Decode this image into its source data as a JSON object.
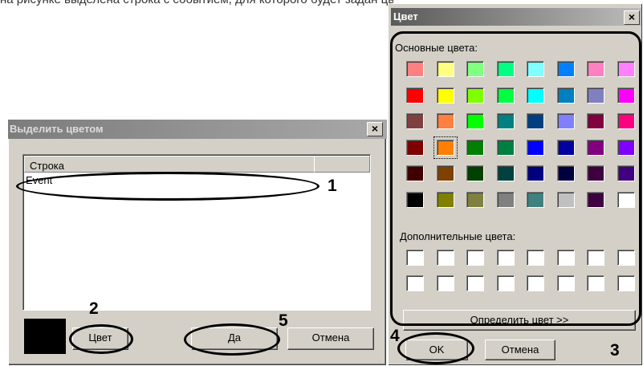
{
  "cutoff_text": "на рисунке выделена строка с событием, для которого будет задан цвет",
  "highlight_dialog": {
    "title": "Выделить цветом",
    "close_label": "×",
    "column_header": "Строка",
    "rows": [
      "Event"
    ],
    "selected_color": "#000000",
    "color_button": "Цвет",
    "ok_button": "Да",
    "cancel_button": "Отмена"
  },
  "color_dialog": {
    "title": "Цвет",
    "close_label": "×",
    "basic_colors_label": "Основные цвета:",
    "custom_colors_label": "Дополнительные цвета:",
    "define_button": "Определить цвет >>",
    "ok_button": "OK",
    "cancel_button": "Отмена",
    "selected_swatch_index": 25,
    "basic_colors": [
      "#ff8080",
      "#ffff80",
      "#80ff80",
      "#00ff80",
      "#80ffff",
      "#0080ff",
      "#ff80c0",
      "#ff80ff",
      "#ff0000",
      "#ffff00",
      "#80ff00",
      "#00ff40",
      "#00ffff",
      "#0080c0",
      "#8080c0",
      "#ff00ff",
      "#804040",
      "#ff8040",
      "#00ff00",
      "#008080",
      "#004080",
      "#8080ff",
      "#800040",
      "#ff0080",
      "#800000",
      "#ff8000",
      "#008000",
      "#008040",
      "#0000ff",
      "#0000a0",
      "#800080",
      "#8000ff",
      "#400000",
      "#804000",
      "#004000",
      "#004040",
      "#000080",
      "#000040",
      "#400040",
      "#400080",
      "#000000",
      "#808000",
      "#808040",
      "#808080",
      "#408080",
      "#c0c0c0",
      "#400040",
      "#ffffff"
    ],
    "custom_colors": [
      "#ffffff",
      "#ffffff",
      "#ffffff",
      "#ffffff",
      "#ffffff",
      "#ffffff",
      "#ffffff",
      "#ffffff",
      "#ffffff",
      "#ffffff",
      "#ffffff",
      "#ffffff",
      "#ffffff",
      "#ffffff",
      "#ffffff",
      "#ffffff"
    ]
  },
  "annotations": {
    "n1": "1",
    "n2": "2",
    "n3": "3",
    "n4": "4",
    "n5": "5"
  }
}
